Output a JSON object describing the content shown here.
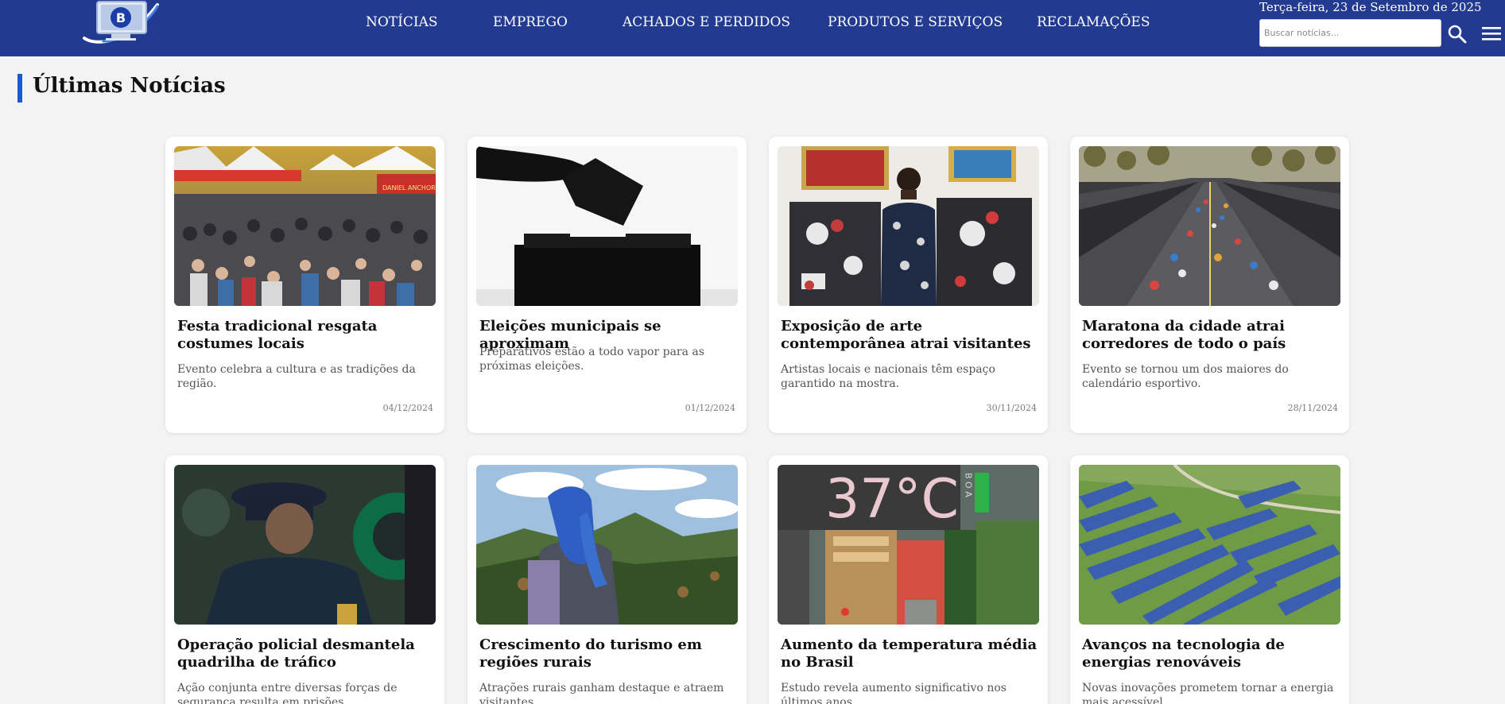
{
  "header": {
    "logo_letter": "B",
    "nav": [
      "NOTÍCIAS",
      "EMPREGO",
      "ACHADOS E PERDIDOS",
      "PRODUTOS E SERVIÇOS",
      "RECLAMAÇÕES"
    ],
    "date": "Terça-feira, 23 de Setembro de 2025",
    "search": {
      "placeholder": "Buscar notícias...",
      "icon": "search-icon"
    },
    "menu_icon": "hamburger-menu-icon",
    "colors": {
      "background": "#223b91",
      "text": "#ffffff"
    }
  },
  "section": {
    "title": "Últimas Notícias",
    "accent": "#1c57d6"
  },
  "cards": [
    {
      "title": "Festa tradicional resgata costumes locais",
      "desc": "Evento celebra a cultura e as tradições da região.",
      "date": "04/12/2024"
    },
    {
      "title": "Eleições municipais se aproximam",
      "desc": "Preparativos estão a todo vapor para as próximas eleições.",
      "date": "01/12/2024"
    },
    {
      "title": "Exposição de arte contemporânea atrai visitantes",
      "desc": "Artistas locais e nacionais têm espaço garantido na mostra.",
      "date": "30/11/2024"
    },
    {
      "title": "Maratona da cidade atrai corredores de todo o país",
      "desc": "Evento se tornou um dos maiores do calendário esportivo.",
      "date": "28/11/2024"
    },
    {
      "title": "Operação policial desmantela quadrilha de tráfico",
      "desc": "Ação conjunta entre diversas forças de segurança resulta em prisões."
    },
    {
      "title": "Crescimento do turismo em regiões rurais",
      "desc": "Atrações rurais ganham destaque e atraem visitantes."
    },
    {
      "title": "Aumento da temperatura média no Brasil",
      "desc": "Estudo revela aumento significativo nos últimos anos."
    },
    {
      "title": "Avanços na tecnologia de energias renováveis",
      "desc": "Novas inovações prometem tornar a energia mais acessível."
    }
  ],
  "image_texts": {
    "thermometer": "37°C",
    "thermometer_side": "B O A",
    "banner": "DANIEL ANCHOR LANCHE"
  }
}
